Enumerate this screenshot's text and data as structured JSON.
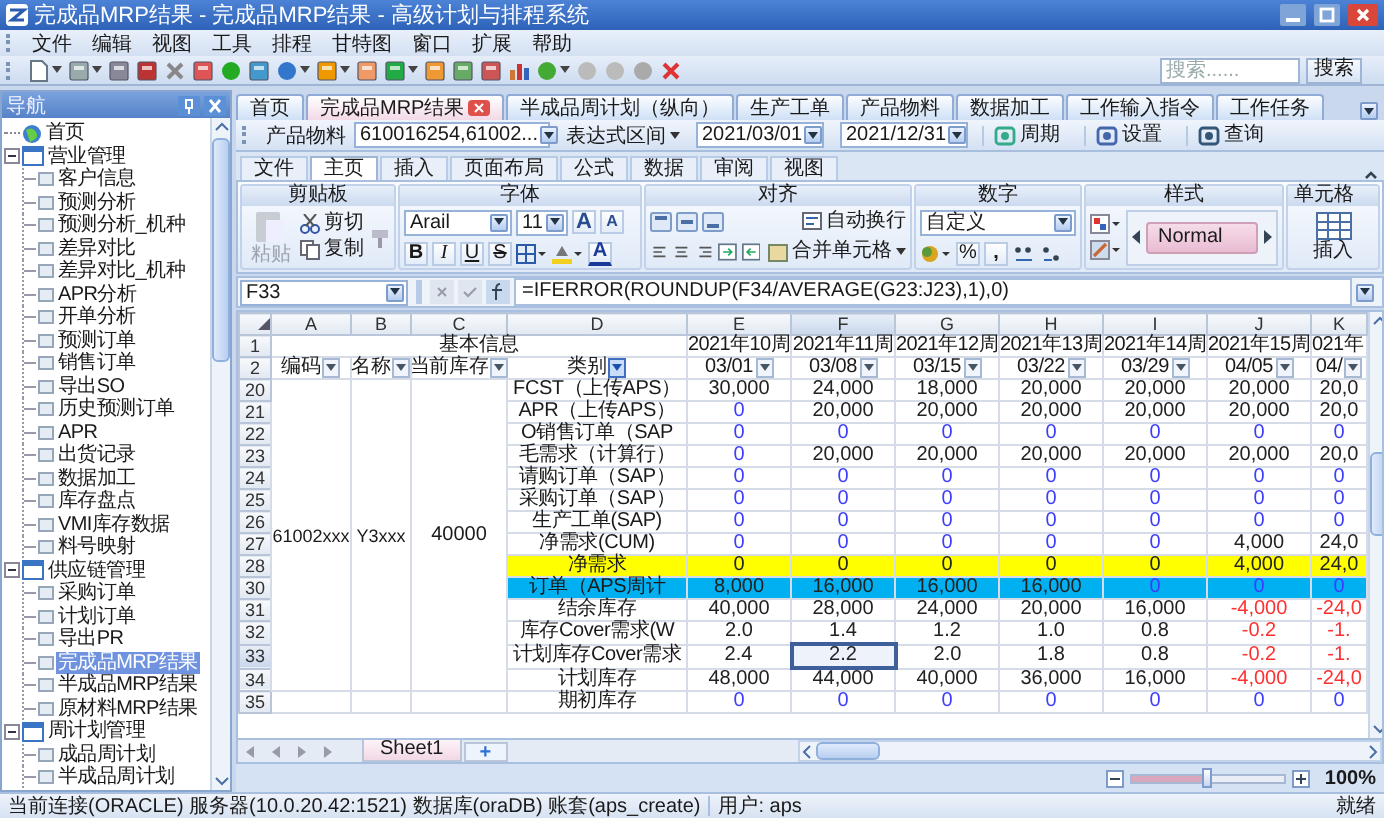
{
  "window": {
    "title": "完成品MRP结果 - 完成品MRP结果 - 高级计划与排程系统"
  },
  "menu": [
    "文件",
    "编辑",
    "视图",
    "工具",
    "排程",
    "甘特图",
    "窗口",
    "扩展",
    "帮助"
  ],
  "toolbar": {
    "search": {
      "placeholder": "搜索......",
      "button": "搜索"
    }
  },
  "navigation": {
    "title": "导航",
    "tree": [
      {
        "label": "首页",
        "kind": "home",
        "selected": false
      },
      {
        "label": "营业管理",
        "kind": "group",
        "expanded": true,
        "selected": false,
        "children": [
          {
            "label": "客户信息",
            "kind": "page",
            "selected": false
          },
          {
            "label": "预测分析",
            "kind": "page",
            "selected": false
          },
          {
            "label": "预测分析_机种",
            "kind": "page",
            "selected": false
          },
          {
            "label": "差异对比",
            "kind": "page",
            "selected": false
          },
          {
            "label": "差异对比_机种",
            "kind": "page",
            "selected": false
          },
          {
            "label": "APR分析",
            "kind": "page",
            "selected": false
          },
          {
            "label": "开单分析",
            "kind": "page",
            "selected": false
          },
          {
            "label": "预测订单",
            "kind": "page",
            "selected": false
          },
          {
            "label": "销售订单",
            "kind": "page",
            "selected": false
          },
          {
            "label": "导出SO",
            "kind": "page",
            "selected": false
          },
          {
            "label": "历史预测订单",
            "kind": "page",
            "selected": false
          },
          {
            "label": "APR",
            "kind": "page",
            "selected": false
          },
          {
            "label": "出货记录",
            "kind": "page",
            "selected": false
          },
          {
            "label": "数据加工",
            "kind": "page",
            "selected": false
          },
          {
            "label": "库存盘点",
            "kind": "page",
            "selected": false
          },
          {
            "label": "VMI库存数据",
            "kind": "page",
            "selected": false
          },
          {
            "label": "料号映射",
            "kind": "page",
            "selected": false
          }
        ]
      },
      {
        "label": "供应链管理",
        "kind": "group",
        "expanded": true,
        "selected": false,
        "children": [
          {
            "label": "采购订单",
            "kind": "page",
            "selected": false
          },
          {
            "label": "计划订单",
            "kind": "page",
            "selected": false
          },
          {
            "label": "导出PR",
            "kind": "page",
            "selected": false
          },
          {
            "label": "完成品MRP结果",
            "kind": "page",
            "selected": true
          },
          {
            "label": "半成品MRP结果",
            "kind": "page",
            "selected": false
          },
          {
            "label": "原材料MRP结果",
            "kind": "page",
            "selected": false
          }
        ]
      },
      {
        "label": "周计划管理",
        "kind": "group",
        "expanded": true,
        "selected": false,
        "children": [
          {
            "label": "成品周计划",
            "kind": "page",
            "selected": false
          },
          {
            "label": "半成品周计划",
            "kind": "page",
            "selected": false
          }
        ]
      }
    ]
  },
  "document_tabs": [
    {
      "label": "首页",
      "selected": false
    },
    {
      "label": "完成品MRP结果",
      "selected": true
    },
    {
      "label": "半成品周计划（纵向）",
      "selected": false
    },
    {
      "label": "生产工单",
      "selected": false
    },
    {
      "label": "产品物料",
      "selected": false
    },
    {
      "label": "数据加工",
      "selected": false
    },
    {
      "label": "工作输入指令",
      "selected": false
    },
    {
      "label": "工作任务",
      "selected": false
    }
  ],
  "filter_bar": {
    "product_label": "产品物料",
    "product_value": "610016254,61002...",
    "range_mode": "表达式区间",
    "start_date": "2021/03/01",
    "end_date": "2021/12/31",
    "buttons": [
      {
        "kind": "period",
        "label": "周期"
      },
      {
        "kind": "settings",
        "label": "设置"
      },
      {
        "kind": "query",
        "label": "查询"
      }
    ]
  },
  "ribbon": {
    "tabs": [
      {
        "label": "文件",
        "selected": false
      },
      {
        "label": "主页",
        "selected": true
      },
      {
        "label": "插入",
        "selected": false
      },
      {
        "label": "页面布局",
        "selected": false
      },
      {
        "label": "公式",
        "selected": false
      },
      {
        "label": "数据",
        "selected": false
      },
      {
        "label": "审阅",
        "selected": false
      },
      {
        "label": "视图",
        "selected": false
      }
    ],
    "clipboard": {
      "title": "剪贴板",
      "paste": {
        "label": "粘贴",
        "disabled": true
      },
      "cut": "剪切",
      "copy": "复制"
    },
    "font": {
      "title": "字体",
      "font_name": "Arail",
      "font_size": "11",
      "grow": "A",
      "shrink": "A",
      "bold": "B",
      "italic": "I",
      "underline": "U",
      "strike": "S",
      "font_color": "A"
    },
    "alignment": {
      "title": "对齐",
      "wrap": "自动换行",
      "merge": "合并单元格"
    },
    "number": {
      "title": "数字",
      "format": "自定义",
      "percent": "%",
      "comma": ","
    },
    "styles": {
      "title": "样式",
      "style": "Normal"
    },
    "cells": {
      "title": "单元格",
      "insert": "插入"
    }
  },
  "formula_bar": {
    "name_box": "F33",
    "formula": "=IFERROR(ROUNDUP(F34/AVERAGE(G23:J23),1),0)"
  },
  "sheet": {
    "columns": [
      "A",
      "B",
      "C",
      "D",
      "E",
      "F",
      "G",
      "H",
      "I",
      "J",
      "K"
    ],
    "title_row": {
      "number": "1",
      "basic_info": "基本信息",
      "weeks": [
        "2021年10周",
        "2021年11周",
        "2021年12周",
        "2021年13周",
        "2021年14周",
        "2021年15周",
        "021年"
      ]
    },
    "filter_row": {
      "number": "2",
      "cells": [
        {
          "text": "编码",
          "filtered": false
        },
        {
          "text": "名称",
          "filtered": false
        },
        {
          "text": "当前库存",
          "filtered": false
        },
        {
          "text": "类别",
          "filtered": true
        },
        {
          "text": "03/01",
          "filtered": false
        },
        {
          "text": "03/08",
          "filtered": false
        },
        {
          "text": "03/15",
          "filtered": false
        },
        {
          "text": "03/22",
          "filtered": false
        },
        {
          "text": "03/29",
          "filtered": false
        },
        {
          "text": "04/05",
          "filtered": false
        },
        {
          "text": "04/",
          "filtered": false
        }
      ]
    },
    "item": {
      "code": "61002xxx",
      "name": "Y3xxx",
      "stock": "40000"
    },
    "rows": [
      {
        "number": "20",
        "grouped": true,
        "color": "#ffffff",
        "category": "FCST（上传APS）",
        "values": [
          {
            "text": "30,000",
            "kind": "plain",
            "selected": false
          },
          {
            "text": "24,000",
            "kind": "plain",
            "selected": false
          },
          {
            "text": "18,000",
            "kind": "plain",
            "selected": false
          },
          {
            "text": "20,000",
            "kind": "plain",
            "selected": false
          },
          {
            "text": "20,000",
            "kind": "plain",
            "selected": false
          },
          {
            "text": "20,000",
            "kind": "plain",
            "selected": false
          },
          {
            "text": "20,0",
            "kind": "plain",
            "selected": false
          }
        ]
      },
      {
        "number": "21",
        "grouped": true,
        "color": "#ffffff",
        "category": "APR（上传APS）",
        "values": [
          {
            "text": "0",
            "kind": "accent",
            "selected": false
          },
          {
            "text": "20,000",
            "kind": "plain",
            "selected": false
          },
          {
            "text": "20,000",
            "kind": "plain",
            "selected": false
          },
          {
            "text": "20,000",
            "kind": "plain",
            "selected": false
          },
          {
            "text": "20,000",
            "kind": "plain",
            "selected": false
          },
          {
            "text": "20,000",
            "kind": "plain",
            "selected": false
          },
          {
            "text": "20,0",
            "kind": "plain",
            "selected": false
          }
        ]
      },
      {
        "number": "22",
        "grouped": true,
        "color": "#ffffff",
        "category": "O销售订单（SAP",
        "values": [
          {
            "text": "0",
            "kind": "accent",
            "selected": false
          },
          {
            "text": "0",
            "kind": "accent",
            "selected": false
          },
          {
            "text": "0",
            "kind": "accent",
            "selected": false
          },
          {
            "text": "0",
            "kind": "accent",
            "selected": false
          },
          {
            "text": "0",
            "kind": "accent",
            "selected": false
          },
          {
            "text": "0",
            "kind": "accent",
            "selected": false
          },
          {
            "text": "0",
            "kind": "accent",
            "selected": false
          }
        ]
      },
      {
        "number": "23",
        "grouped": true,
        "color": "#ffffff",
        "category": "毛需求（计算行）",
        "values": [
          {
            "text": "0",
            "kind": "accent",
            "selected": false
          },
          {
            "text": "20,000",
            "kind": "plain",
            "selected": false
          },
          {
            "text": "20,000",
            "kind": "plain",
            "selected": false
          },
          {
            "text": "20,000",
            "kind": "plain",
            "selected": false
          },
          {
            "text": "20,000",
            "kind": "plain",
            "selected": false
          },
          {
            "text": "20,000",
            "kind": "plain",
            "selected": false
          },
          {
            "text": "20,0",
            "kind": "plain",
            "selected": false
          }
        ]
      },
      {
        "number": "24",
        "grouped": true,
        "color": "#ffffff",
        "category": "请购订单（SAP）",
        "values": [
          {
            "text": "0",
            "kind": "accent",
            "selected": false
          },
          {
            "text": "0",
            "kind": "accent",
            "selected": false
          },
          {
            "text": "0",
            "kind": "accent",
            "selected": false
          },
          {
            "text": "0",
            "kind": "accent",
            "selected": false
          },
          {
            "text": "0",
            "kind": "accent",
            "selected": false
          },
          {
            "text": "0",
            "kind": "accent",
            "selected": false
          },
          {
            "text": "0",
            "kind": "accent",
            "selected": false
          }
        ]
      },
      {
        "number": "25",
        "grouped": true,
        "color": "#ffffff",
        "category": "采购订单（SAP）",
        "values": [
          {
            "text": "0",
            "kind": "accent",
            "selected": false
          },
          {
            "text": "0",
            "kind": "accent",
            "selected": false
          },
          {
            "text": "0",
            "kind": "accent",
            "selected": false
          },
          {
            "text": "0",
            "kind": "accent",
            "selected": false
          },
          {
            "text": "0",
            "kind": "accent",
            "selected": false
          },
          {
            "text": "0",
            "kind": "accent",
            "selected": false
          },
          {
            "text": "0",
            "kind": "accent",
            "selected": false
          }
        ]
      },
      {
        "number": "26",
        "grouped": true,
        "color": "#ffffff",
        "category": "生产工单(SAP)",
        "values": [
          {
            "text": "0",
            "kind": "accent",
            "selected": false
          },
          {
            "text": "0",
            "kind": "accent",
            "selected": false
          },
          {
            "text": "0",
            "kind": "accent",
            "selected": false
          },
          {
            "text": "0",
            "kind": "accent",
            "selected": false
          },
          {
            "text": "0",
            "kind": "accent",
            "selected": false
          },
          {
            "text": "0",
            "kind": "accent",
            "selected": false
          },
          {
            "text": "0",
            "kind": "accent",
            "selected": false
          }
        ]
      },
      {
        "number": "27",
        "grouped": true,
        "color": "#ffffff",
        "category": "净需求(CUM)",
        "values": [
          {
            "text": "0",
            "kind": "accent",
            "selected": false
          },
          {
            "text": "0",
            "kind": "accent",
            "selected": false
          },
          {
            "text": "0",
            "kind": "accent",
            "selected": false
          },
          {
            "text": "0",
            "kind": "accent",
            "selected": false
          },
          {
            "text": "0",
            "kind": "accent",
            "selected": false
          },
          {
            "text": "4,000",
            "kind": "plain",
            "selected": false
          },
          {
            "text": "24,0",
            "kind": "plain",
            "selected": false
          }
        ]
      },
      {
        "number": "28",
        "grouped": true,
        "color": "#ffff00",
        "category": "净需求",
        "values": [
          {
            "text": "0",
            "kind": "plain",
            "selected": false
          },
          {
            "text": "0",
            "kind": "plain",
            "selected": false
          },
          {
            "text": "0",
            "kind": "plain",
            "selected": false
          },
          {
            "text": "0",
            "kind": "plain",
            "selected": false
          },
          {
            "text": "0",
            "kind": "plain",
            "selected": false
          },
          {
            "text": "4,000",
            "kind": "plain",
            "selected": false
          },
          {
            "text": "24,0",
            "kind": "plain",
            "selected": false
          }
        ]
      },
      {
        "number": "30",
        "grouped": true,
        "color": "#00b0f0",
        "category": "订单（APS周计",
        "values": [
          {
            "text": "8,000",
            "kind": "plain",
            "selected": false
          },
          {
            "text": "16,000",
            "kind": "plain",
            "selected": false
          },
          {
            "text": "16,000",
            "kind": "plain",
            "selected": false
          },
          {
            "text": "16,000",
            "kind": "plain",
            "selected": false
          },
          {
            "text": "0",
            "kind": "accent",
            "selected": false
          },
          {
            "text": "0",
            "kind": "accent",
            "selected": false
          },
          {
            "text": "0",
            "kind": "accent",
            "selected": false
          }
        ]
      },
      {
        "number": "31",
        "grouped": true,
        "color": "#ffffff",
        "category": "结余库存",
        "values": [
          {
            "text": "40,000",
            "kind": "plain",
            "selected": false
          },
          {
            "text": "28,000",
            "kind": "plain",
            "selected": false
          },
          {
            "text": "24,000",
            "kind": "plain",
            "selected": false
          },
          {
            "text": "20,000",
            "kind": "plain",
            "selected": false
          },
          {
            "text": "16,000",
            "kind": "plain",
            "selected": false
          },
          {
            "text": "-4,000",
            "kind": "negative",
            "selected": false
          },
          {
            "text": "-24,0",
            "kind": "negative",
            "selected": false
          }
        ]
      },
      {
        "number": "32",
        "grouped": true,
        "color": "#ffffff",
        "category": "库存Cover需求(W",
        "values": [
          {
            "text": "2.0",
            "kind": "plain",
            "selected": false
          },
          {
            "text": "1.4",
            "kind": "plain",
            "selected": false
          },
          {
            "text": "1.2",
            "kind": "plain",
            "selected": false
          },
          {
            "text": "1.0",
            "kind": "plain",
            "selected": false
          },
          {
            "text": "0.8",
            "kind": "plain",
            "selected": false
          },
          {
            "text": "-0.2",
            "kind": "negative",
            "selected": false
          },
          {
            "text": "-1.",
            "kind": "negative",
            "selected": false
          }
        ]
      },
      {
        "number": "33",
        "grouped": true,
        "color": "#ffffff",
        "category": "计划库存Cover需求",
        "values": [
          {
            "text": "2.4",
            "kind": "plain",
            "selected": false
          },
          {
            "text": "2.2",
            "kind": "plain",
            "selected": true
          },
          {
            "text": "2.0",
            "kind": "plain",
            "selected": false
          },
          {
            "text": "1.8",
            "kind": "plain",
            "selected": false
          },
          {
            "text": "0.8",
            "kind": "plain",
            "selected": false
          },
          {
            "text": "-0.2",
            "kind": "negative",
            "selected": false
          },
          {
            "text": "-1.",
            "kind": "negative",
            "selected": false
          }
        ]
      },
      {
        "number": "34",
        "grouped": true,
        "color": "#ffffff",
        "category": "计划库存",
        "values": [
          {
            "text": "48,000",
            "kind": "plain",
            "selected": false
          },
          {
            "text": "44,000",
            "kind": "plain",
            "selected": false
          },
          {
            "text": "40,000",
            "kind": "plain",
            "selected": false
          },
          {
            "text": "36,000",
            "kind": "plain",
            "selected": false
          },
          {
            "text": "16,000",
            "kind": "plain",
            "selected": false
          },
          {
            "text": "-4,000",
            "kind": "negative",
            "selected": false
          },
          {
            "text": "-24,0",
            "kind": "negative",
            "selected": false
          }
        ]
      },
      {
        "number": "35",
        "grouped": false,
        "color": "#ffffff",
        "category": "期初库存",
        "values": [
          {
            "text": "0",
            "kind": "accent",
            "selected": false
          },
          {
            "text": "0",
            "kind": "accent",
            "selected": false
          },
          {
            "text": "0",
            "kind": "accent",
            "selected": false
          },
          {
            "text": "0",
            "kind": "accent",
            "selected": false
          },
          {
            "text": "0",
            "kind": "accent",
            "selected": false
          },
          {
            "text": "0",
            "kind": "accent",
            "selected": false
          },
          {
            "text": "0",
            "kind": "accent",
            "selected": false
          }
        ]
      }
    ]
  },
  "sheet_tabs": {
    "tabs": [
      {
        "label": "Sheet1",
        "selected": true
      }
    ],
    "add": "+"
  },
  "zoom": {
    "level": 0.5,
    "reading": "100%"
  },
  "status_bar": {
    "connection": "当前连接(ORACLE) 服务器(10.0.20.42:1521) 数据库(oraDB) 账套(aps_create)",
    "user": "用户: aps",
    "state": "就绪"
  }
}
